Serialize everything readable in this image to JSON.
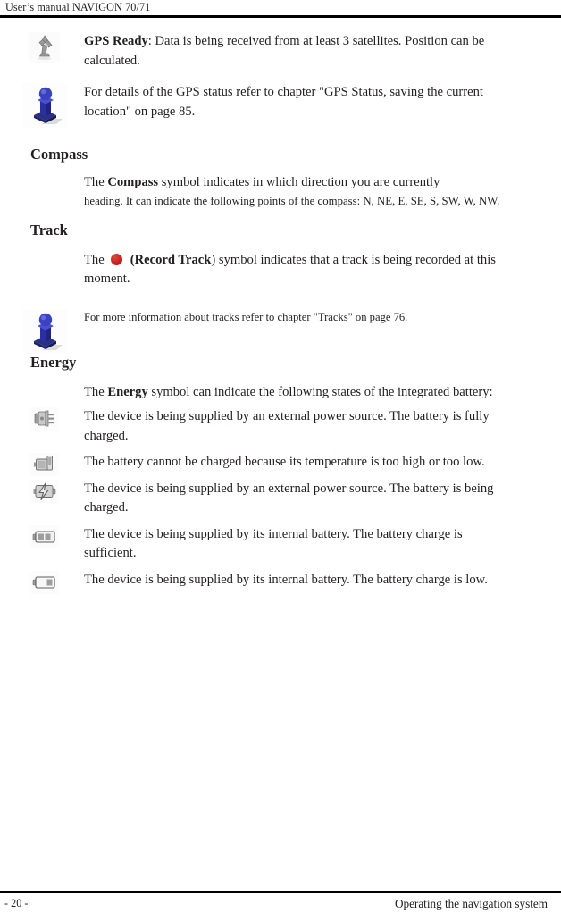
{
  "document": {
    "header_title": "User’s manual NAVIGON 70/71",
    "footer_page": "- 20 -",
    "footer_chapter": "Operating the navigation system"
  },
  "colors": {
    "rule": "#000000",
    "text": "#231f20",
    "note_icon_blue": "#3a40a8",
    "record_red": "#c62222",
    "icon_grey": "#8c8c8c"
  },
  "content": {
    "gps_ready": {
      "icon": "satellite-icon",
      "lead_bold": "GPS Ready",
      "text_rest": ": Data is being received from at least 3 satellites. Position can be calculated."
    },
    "gps_note": {
      "icon": "info-pawn-icon",
      "text": "For details of the GPS status refer to chapter \"GPS Status, saving the current location\" on page 85."
    },
    "compass": {
      "heading": "Compass",
      "line1_pre": "The ",
      "line1_bold": "Compass",
      "line1_post": " symbol indicates in which direction you are currently",
      "line2": "heading. It can indicate the following points of the compass: N, NE, E, SE, S, SW, W, NW."
    },
    "track": {
      "heading": "Track",
      "lead": "The",
      "icon": "record-track-dot-icon",
      "paren_open": "(",
      "bold": "Record Track",
      "paren_close": ")",
      "rest": " symbol indicates that a track is being recorded at this moment.",
      "note_icon": "info-pawn-icon",
      "note_text": "For more information about tracks refer to chapter \"Tracks\" on page 76."
    },
    "energy": {
      "heading": "Energy",
      "intro_pre": "The ",
      "intro_bold": "Energy",
      "intro_post": " symbol can indicate the following states of the integrated battery:",
      "states": [
        {
          "icon": "power-plug-icon",
          "text": "The device is being supplied by an external power source. The battery is fully charged."
        },
        {
          "icon": "battery-temperature-fault-icon",
          "text": "The battery cannot be charged because its temperature is too high or too low."
        },
        {
          "icon": "battery-charging-icon",
          "text": "The device is being supplied by an external power source. The battery is being charged."
        },
        {
          "icon": "battery-sufficient-icon",
          "text": "The device is being supplied by its internal battery. The battery charge is sufficient."
        },
        {
          "icon": "battery-low-icon",
          "text": "The device is being supplied by its internal battery. The battery charge is low."
        }
      ]
    }
  }
}
